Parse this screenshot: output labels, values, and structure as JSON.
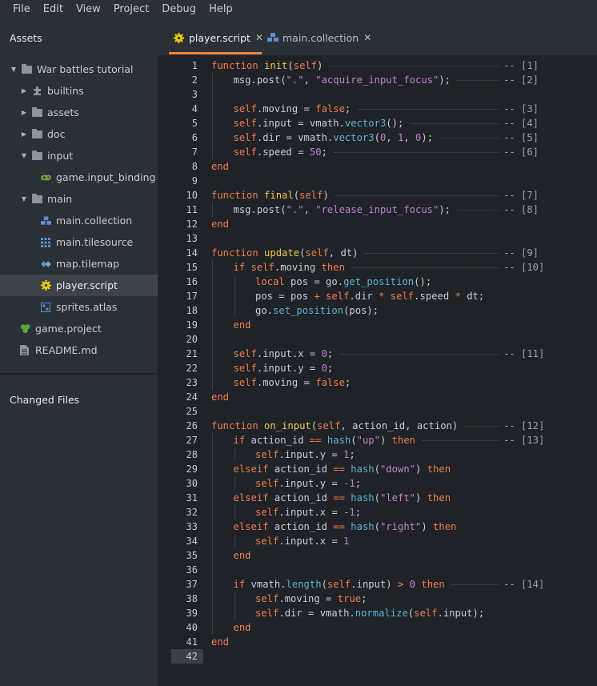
{
  "menu": [
    "File",
    "Edit",
    "View",
    "Project",
    "Debug",
    "Help"
  ],
  "assets_title": "Assets",
  "changed_files_title": "Changed Files",
  "tree": [
    {
      "label": "War battles tutorial",
      "depth": 0,
      "arrow": "down",
      "icon": "folder-icon"
    },
    {
      "label": "builtins",
      "depth": 1,
      "arrow": "right",
      "icon": "puzzle-icon"
    },
    {
      "label": "assets",
      "depth": 1,
      "arrow": "right",
      "icon": "folder-icon"
    },
    {
      "label": "doc",
      "depth": 1,
      "arrow": "right",
      "icon": "folder-icon"
    },
    {
      "label": "input",
      "depth": 1,
      "arrow": "down",
      "icon": "folder-icon"
    },
    {
      "label": "game.input_binding",
      "depth": 2,
      "arrow": "none",
      "icon": "gamepad-icon"
    },
    {
      "label": "main",
      "depth": 1,
      "arrow": "down",
      "icon": "folder-icon"
    },
    {
      "label": "main.collection",
      "depth": 2,
      "arrow": "none",
      "icon": "collection-icon"
    },
    {
      "label": "main.tilesource",
      "depth": 2,
      "arrow": "none",
      "icon": "tilesource-icon"
    },
    {
      "label": "map.tilemap",
      "depth": 2,
      "arrow": "none",
      "icon": "tilemap-icon"
    },
    {
      "label": "player.script",
      "depth": 2,
      "arrow": "none",
      "icon": "script-gear-icon",
      "selected": true
    },
    {
      "label": "sprites.atlas",
      "depth": 2,
      "arrow": "none",
      "icon": "atlas-icon"
    },
    {
      "label": "game.project",
      "depth": 1,
      "arrow": "none",
      "icon": "project-icon"
    },
    {
      "label": "README.md",
      "depth": 1,
      "arrow": "none",
      "icon": "document-icon"
    }
  ],
  "tabs": [
    {
      "label": "player.script",
      "icon": "script-gear-icon",
      "active": true
    },
    {
      "label": "main.collection",
      "icon": "collection-icon",
      "active": false
    }
  ],
  "close_glyph": "✕",
  "current_line": 42,
  "colors": {
    "accent": "#f0873a",
    "keyword": "#f37c4d",
    "function": "#f5c451",
    "string": "#c67fd6",
    "method": "#5fb2d4"
  },
  "code_lines": [
    {
      "indent": 0,
      "tokens": [
        [
          "k",
          "function "
        ],
        [
          "f",
          "init"
        ],
        [
          "p",
          "("
        ],
        [
          "k",
          "self"
        ],
        [
          "p",
          ")"
        ]
      ],
      "ann": "-- [1]"
    },
    {
      "indent": 1,
      "tokens": [
        [
          "p",
          "msg.post("
        ],
        [
          "s",
          "\".\""
        ],
        [
          "p",
          ", "
        ],
        [
          "s",
          "\"acquire_input_focus\""
        ],
        [
          "p",
          ");"
        ]
      ],
      "ann": "-- [2]"
    },
    {
      "indent": 1,
      "tokens": [],
      "ann": ""
    },
    {
      "indent": 1,
      "tokens": [
        [
          "k",
          "self"
        ],
        [
          "p",
          ".moving = "
        ],
        [
          "k",
          "false"
        ],
        [
          "p",
          ";"
        ]
      ],
      "ann": "-- [3]"
    },
    {
      "indent": 1,
      "tokens": [
        [
          "k",
          "self"
        ],
        [
          "p",
          ".input = vmath."
        ],
        [
          "m",
          "vector3"
        ],
        [
          "p",
          "();"
        ]
      ],
      "ann": "-- [4]"
    },
    {
      "indent": 1,
      "tokens": [
        [
          "k",
          "self"
        ],
        [
          "p",
          ".dir = vmath."
        ],
        [
          "m",
          "vector3"
        ],
        [
          "p",
          "("
        ],
        [
          "n",
          "0"
        ],
        [
          "p",
          ", "
        ],
        [
          "n",
          "1"
        ],
        [
          "p",
          ", "
        ],
        [
          "n",
          "0"
        ],
        [
          "p",
          ");"
        ]
      ],
      "ann": "-- [5]"
    },
    {
      "indent": 1,
      "tokens": [
        [
          "k",
          "self"
        ],
        [
          "p",
          ".speed = "
        ],
        [
          "n",
          "50"
        ],
        [
          "p",
          ";"
        ]
      ],
      "ann": "-- [6]"
    },
    {
      "indent": 0,
      "tokens": [
        [
          "k",
          "end"
        ]
      ],
      "ann": ""
    },
    {
      "indent": 0,
      "tokens": [],
      "ann": ""
    },
    {
      "indent": 0,
      "tokens": [
        [
          "k",
          "function "
        ],
        [
          "f",
          "final"
        ],
        [
          "p",
          "("
        ],
        [
          "k",
          "self"
        ],
        [
          "p",
          ")"
        ]
      ],
      "ann": "-- [7]"
    },
    {
      "indent": 1,
      "tokens": [
        [
          "p",
          "msg.post("
        ],
        [
          "s",
          "\".\""
        ],
        [
          "p",
          ", "
        ],
        [
          "s",
          "\"release_input_focus\""
        ],
        [
          "p",
          ");"
        ]
      ],
      "ann": "-- [8]"
    },
    {
      "indent": 0,
      "tokens": [
        [
          "k",
          "end"
        ]
      ],
      "ann": ""
    },
    {
      "indent": 0,
      "tokens": [],
      "ann": ""
    },
    {
      "indent": 0,
      "tokens": [
        [
          "k",
          "function "
        ],
        [
          "f",
          "update"
        ],
        [
          "p",
          "("
        ],
        [
          "k",
          "self"
        ],
        [
          "p",
          ", dt)"
        ]
      ],
      "ann": "-- [9]"
    },
    {
      "indent": 1,
      "tokens": [
        [
          "k",
          "if "
        ],
        [
          "k",
          "self"
        ],
        [
          "p",
          ".moving "
        ],
        [
          "k",
          "then"
        ]
      ],
      "ann": "-- [10]"
    },
    {
      "indent": 2,
      "tokens": [
        [
          "k",
          "local "
        ],
        [
          "p",
          "pos = go."
        ],
        [
          "m",
          "get_position"
        ],
        [
          "p",
          "();"
        ]
      ],
      "ann": ""
    },
    {
      "indent": 2,
      "tokens": [
        [
          "p",
          "pos = pos "
        ],
        [
          "k",
          "+ "
        ],
        [
          "k",
          "self"
        ],
        [
          "p",
          ".dir "
        ],
        [
          "k",
          "* "
        ],
        [
          "k",
          "self"
        ],
        [
          "p",
          ".speed "
        ],
        [
          "k",
          "* "
        ],
        [
          "p",
          "dt;"
        ]
      ],
      "ann": ""
    },
    {
      "indent": 2,
      "tokens": [
        [
          "p",
          "go."
        ],
        [
          "m",
          "set_position"
        ],
        [
          "p",
          "(pos);"
        ]
      ],
      "ann": ""
    },
    {
      "indent": 1,
      "tokens": [
        [
          "k",
          "end"
        ]
      ],
      "ann": ""
    },
    {
      "indent": 1,
      "tokens": [],
      "ann": ""
    },
    {
      "indent": 1,
      "tokens": [
        [
          "k",
          "self"
        ],
        [
          "p",
          ".input.x = "
        ],
        [
          "n",
          "0"
        ],
        [
          "p",
          ";"
        ]
      ],
      "ann": "-- [11]"
    },
    {
      "indent": 1,
      "tokens": [
        [
          "k",
          "self"
        ],
        [
          "p",
          ".input.y = "
        ],
        [
          "n",
          "0"
        ],
        [
          "p",
          ";"
        ]
      ],
      "ann": ""
    },
    {
      "indent": 1,
      "tokens": [
        [
          "k",
          "self"
        ],
        [
          "p",
          ".moving = "
        ],
        [
          "k",
          "false"
        ],
        [
          "p",
          ";"
        ]
      ],
      "ann": ""
    },
    {
      "indent": 0,
      "tokens": [
        [
          "k",
          "end"
        ]
      ],
      "ann": ""
    },
    {
      "indent": 0,
      "tokens": [],
      "ann": ""
    },
    {
      "indent": 0,
      "tokens": [
        [
          "k",
          "function "
        ],
        [
          "f",
          "on_input"
        ],
        [
          "p",
          "("
        ],
        [
          "k",
          "self"
        ],
        [
          "p",
          ", action_id, action)"
        ]
      ],
      "ann": "-- [12]"
    },
    {
      "indent": 1,
      "tokens": [
        [
          "k",
          "if "
        ],
        [
          "p",
          "action_id "
        ],
        [
          "k",
          "== "
        ],
        [
          "m",
          "hash"
        ],
        [
          "p",
          "("
        ],
        [
          "s",
          "\"up\""
        ],
        [
          "p",
          ") "
        ],
        [
          "k",
          "then"
        ]
      ],
      "ann": "-- [13]"
    },
    {
      "indent": 2,
      "tokens": [
        [
          "k",
          "self"
        ],
        [
          "p",
          ".input.y = "
        ],
        [
          "n",
          "1"
        ],
        [
          "p",
          ";"
        ]
      ],
      "ann": ""
    },
    {
      "indent": 1,
      "tokens": [
        [
          "k",
          "elseif "
        ],
        [
          "p",
          "action_id "
        ],
        [
          "k",
          "== "
        ],
        [
          "m",
          "hash"
        ],
        [
          "p",
          "("
        ],
        [
          "s",
          "\"down\""
        ],
        [
          "p",
          ") "
        ],
        [
          "k",
          "then"
        ]
      ],
      "ann": ""
    },
    {
      "indent": 2,
      "tokens": [
        [
          "k",
          "self"
        ],
        [
          "p",
          ".input.y = "
        ],
        [
          "n",
          "-1"
        ],
        [
          "p",
          ";"
        ]
      ],
      "ann": ""
    },
    {
      "indent": 1,
      "tokens": [
        [
          "k",
          "elseif "
        ],
        [
          "p",
          "action_id "
        ],
        [
          "k",
          "== "
        ],
        [
          "m",
          "hash"
        ],
        [
          "p",
          "("
        ],
        [
          "s",
          "\"left\""
        ],
        [
          "p",
          ") "
        ],
        [
          "k",
          "then"
        ]
      ],
      "ann": ""
    },
    {
      "indent": 2,
      "tokens": [
        [
          "k",
          "self"
        ],
        [
          "p",
          ".input.x = "
        ],
        [
          "n",
          "-1"
        ],
        [
          "p",
          ";"
        ]
      ],
      "ann": ""
    },
    {
      "indent": 1,
      "tokens": [
        [
          "k",
          "elseif "
        ],
        [
          "p",
          "action_id "
        ],
        [
          "k",
          "== "
        ],
        [
          "m",
          "hash"
        ],
        [
          "p",
          "("
        ],
        [
          "s",
          "\"right\""
        ],
        [
          "p",
          ") "
        ],
        [
          "k",
          "then"
        ]
      ],
      "ann": ""
    },
    {
      "indent": 2,
      "tokens": [
        [
          "k",
          "self"
        ],
        [
          "p",
          ".input.x = "
        ],
        [
          "n",
          "1"
        ]
      ],
      "ann": ""
    },
    {
      "indent": 1,
      "tokens": [
        [
          "k",
          "end"
        ]
      ],
      "ann": ""
    },
    {
      "indent": 1,
      "tokens": [],
      "ann": ""
    },
    {
      "indent": 1,
      "tokens": [
        [
          "k",
          "if "
        ],
        [
          "p",
          "vmath."
        ],
        [
          "m",
          "length"
        ],
        [
          "p",
          "("
        ],
        [
          "k",
          "self"
        ],
        [
          "p",
          ".input) "
        ],
        [
          "k",
          "> "
        ],
        [
          "n",
          "0 "
        ],
        [
          "k",
          "then"
        ]
      ],
      "ann": "-- [14]"
    },
    {
      "indent": 2,
      "tokens": [
        [
          "k",
          "self"
        ],
        [
          "p",
          ".moving = "
        ],
        [
          "k",
          "true"
        ],
        [
          "p",
          ";"
        ]
      ],
      "ann": ""
    },
    {
      "indent": 2,
      "tokens": [
        [
          "k",
          "self"
        ],
        [
          "p",
          ".dir = vmath."
        ],
        [
          "m",
          "normalize"
        ],
        [
          "p",
          "("
        ],
        [
          "k",
          "self"
        ],
        [
          "p",
          ".input);"
        ]
      ],
      "ann": ""
    },
    {
      "indent": 1,
      "tokens": [
        [
          "k",
          "end"
        ]
      ],
      "ann": ""
    },
    {
      "indent": 0,
      "tokens": [
        [
          "k",
          "end"
        ]
      ],
      "ann": ""
    },
    {
      "indent": 0,
      "tokens": [],
      "ann": ""
    }
  ]
}
